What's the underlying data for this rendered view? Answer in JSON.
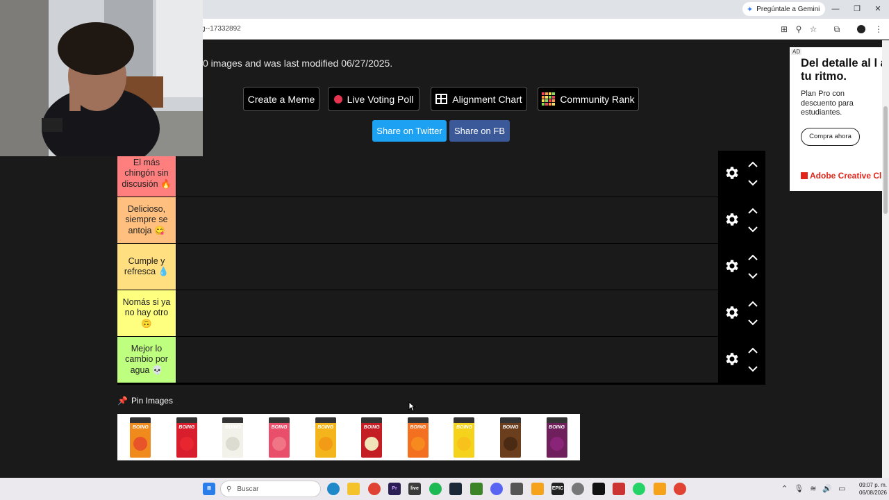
{
  "browser": {
    "gemini_label": "Pregúntale a Gemini",
    "url_fragment": "g--17332892"
  },
  "page": {
    "description": "0 images and was last modified 06/27/2025.",
    "buttons": {
      "meme": "Create a Meme",
      "poll": "Live Voting Poll",
      "alignment": "Alignment Chart",
      "rank": "Community Rank"
    },
    "share": {
      "twitter": "Share on Twitter",
      "fb": "Share on FB"
    },
    "tiers": [
      {
        "label": "El más chingón sin discusión 🔥",
        "color": "#ff7f7f"
      },
      {
        "label": "Delicioso, siempre se antoja 😋",
        "color": "#ffbf7f"
      },
      {
        "label": "Cumple y refresca 💧",
        "color": "#ffdf7f"
      },
      {
        "label": "Nomás si ya no hay otro 🙃",
        "color": "#ffff7f"
      },
      {
        "label": "Mejor lo cambio por agua 💀",
        "color": "#bfff7f"
      }
    ],
    "pin_title": "Pin Images",
    "pin_items": [
      {
        "name": "Boing durazno",
        "color": "#f08a1c",
        "fruit": "#e8532a"
      },
      {
        "name": "Boing fresa",
        "color": "#d81e2c",
        "fruit": "#e8262f"
      },
      {
        "name": "Boing guanábana",
        "color": "#f2f2ea",
        "fruit": "#dcdcd0"
      },
      {
        "name": "Boing guayaba",
        "color": "#e94f6a",
        "fruit": "#f07686"
      },
      {
        "name": "Boing mango",
        "color": "#f3b51b",
        "fruit": "#f29b16"
      },
      {
        "name": "Boing manzana",
        "color": "#c41d24",
        "fruit": "#f1e4b9"
      },
      {
        "name": "Boing naranja",
        "color": "#f37021",
        "fruit": "#f78a1e"
      },
      {
        "name": "Boing piña",
        "color": "#f5d21b",
        "fruit": "#f7c21b"
      },
      {
        "name": "Boing chocolate",
        "color": "#6b3e1d",
        "fruit": "#4a2a12"
      },
      {
        "name": "Boing uva",
        "color": "#6e1f5c",
        "fruit": "#8a2478"
      }
    ],
    "pin_brand": "BOING"
  },
  "ad": {
    "tag": "AD",
    "headline": "Del detalle al l a tu ritmo.",
    "subtext": "Plan Pro con descuento para estudiantes.",
    "cta": "Compra ahora",
    "brand": "Adobe Creative Clou"
  },
  "taskbar": {
    "search_placeholder": "Buscar",
    "time": "09:07 p. m.",
    "date": "06/08/2026"
  }
}
